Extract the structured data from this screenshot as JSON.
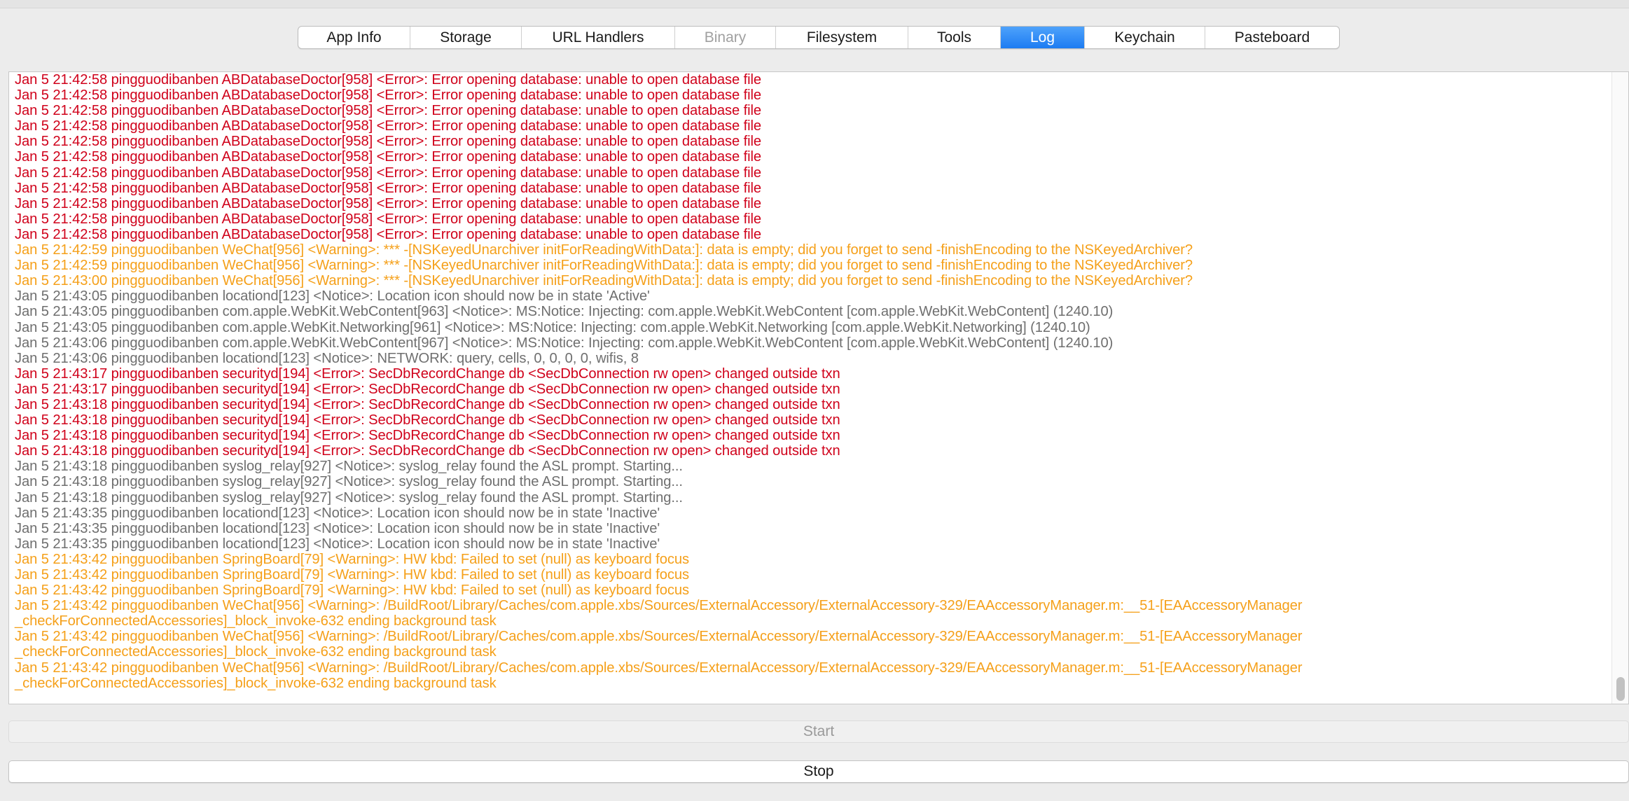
{
  "tabs": [
    {
      "label": "App Info",
      "state": "normal"
    },
    {
      "label": "Storage",
      "state": "normal"
    },
    {
      "label": "URL Handlers",
      "state": "normal"
    },
    {
      "label": "Binary",
      "state": "disabled"
    },
    {
      "label": "Filesystem",
      "state": "normal"
    },
    {
      "label": "Tools",
      "state": "normal"
    },
    {
      "label": "Log",
      "state": "active"
    },
    {
      "label": "Keychain",
      "state": "normal"
    },
    {
      "label": "Pasteboard",
      "state": "normal"
    }
  ],
  "colors": {
    "error": "#d0021b",
    "warning": "#f5a01a",
    "notice": "#6f6f6f",
    "active_tab": "#1d7cf2"
  },
  "log": [
    {
      "level": "error",
      "text": "Jan 5 21:42:58 pingguodibanben ABDatabaseDoctor[958] <Error>: Error opening database: unable to open database file"
    },
    {
      "level": "error",
      "text": "Jan 5 21:42:58 pingguodibanben ABDatabaseDoctor[958] <Error>: Error opening database: unable to open database file"
    },
    {
      "level": "error",
      "text": "Jan 5 21:42:58 pingguodibanben ABDatabaseDoctor[958] <Error>: Error opening database: unable to open database file"
    },
    {
      "level": "error",
      "text": "Jan 5 21:42:58 pingguodibanben ABDatabaseDoctor[958] <Error>: Error opening database: unable to open database file"
    },
    {
      "level": "error",
      "text": "Jan 5 21:42:58 pingguodibanben ABDatabaseDoctor[958] <Error>: Error opening database: unable to open database file"
    },
    {
      "level": "error",
      "text": "Jan 5 21:42:58 pingguodibanben ABDatabaseDoctor[958] <Error>: Error opening database: unable to open database file"
    },
    {
      "level": "error",
      "text": "Jan 5 21:42:58 pingguodibanben ABDatabaseDoctor[958] <Error>: Error opening database: unable to open database file"
    },
    {
      "level": "error",
      "text": "Jan 5 21:42:58 pingguodibanben ABDatabaseDoctor[958] <Error>: Error opening database: unable to open database file"
    },
    {
      "level": "error",
      "text": "Jan 5 21:42:58 pingguodibanben ABDatabaseDoctor[958] <Error>: Error opening database: unable to open database file"
    },
    {
      "level": "error",
      "text": "Jan 5 21:42:58 pingguodibanben ABDatabaseDoctor[958] <Error>: Error opening database: unable to open database file"
    },
    {
      "level": "error",
      "text": "Jan 5 21:42:58 pingguodibanben ABDatabaseDoctor[958] <Error>: Error opening database: unable to open database file"
    },
    {
      "level": "warning",
      "text": "Jan 5 21:42:59 pingguodibanben WeChat[956] <Warning>: *** -[NSKeyedUnarchiver initForReadingWithData:]: data is empty; did you forget to send -finishEncoding to the NSKeyedArchiver?"
    },
    {
      "level": "warning",
      "text": "Jan 5 21:42:59 pingguodibanben WeChat[956] <Warning>: *** -[NSKeyedUnarchiver initForReadingWithData:]: data is empty; did you forget to send -finishEncoding to the NSKeyedArchiver?"
    },
    {
      "level": "warning",
      "text": "Jan 5 21:43:00 pingguodibanben WeChat[956] <Warning>: *** -[NSKeyedUnarchiver initForReadingWithData:]: data is empty; did you forget to send -finishEncoding to the NSKeyedArchiver?"
    },
    {
      "level": "notice",
      "text": "Jan 5 21:43:05 pingguodibanben locationd[123] <Notice>: Location icon should now be in state 'Active'"
    },
    {
      "level": "notice",
      "text": "Jan 5 21:43:05 pingguodibanben com.apple.WebKit.WebContent[963] <Notice>: MS:Notice: Injecting: com.apple.WebKit.WebContent [com.apple.WebKit.WebContent] (1240.10)"
    },
    {
      "level": "notice",
      "text": "Jan 5 21:43:05 pingguodibanben com.apple.WebKit.Networking[961] <Notice>: MS:Notice: Injecting: com.apple.WebKit.Networking [com.apple.WebKit.Networking] (1240.10)"
    },
    {
      "level": "notice",
      "text": "Jan 5 21:43:06 pingguodibanben com.apple.WebKit.WebContent[967] <Notice>: MS:Notice: Injecting: com.apple.WebKit.WebContent [com.apple.WebKit.WebContent] (1240.10)"
    },
    {
      "level": "notice",
      "text": "Jan 5 21:43:06 pingguodibanben locationd[123] <Notice>: NETWORK: query, cells, 0, 0, 0, 0, wifis, 8"
    },
    {
      "level": "error",
      "text": "Jan 5 21:43:17 pingguodibanben securityd[194] <Error>: SecDbRecordChange db <SecDbConnection rw open> changed outside txn"
    },
    {
      "level": "error",
      "text": "Jan 5 21:43:17 pingguodibanben securityd[194] <Error>: SecDbRecordChange db <SecDbConnection rw open> changed outside txn"
    },
    {
      "level": "error",
      "text": "Jan 5 21:43:18 pingguodibanben securityd[194] <Error>: SecDbRecordChange db <SecDbConnection rw open> changed outside txn"
    },
    {
      "level": "error",
      "text": "Jan 5 21:43:18 pingguodibanben securityd[194] <Error>: SecDbRecordChange db <SecDbConnection rw open> changed outside txn"
    },
    {
      "level": "error",
      "text": "Jan 5 21:43:18 pingguodibanben securityd[194] <Error>: SecDbRecordChange db <SecDbConnection rw open> changed outside txn"
    },
    {
      "level": "error",
      "text": "Jan 5 21:43:18 pingguodibanben securityd[194] <Error>: SecDbRecordChange db <SecDbConnection rw open> changed outside txn"
    },
    {
      "level": "notice",
      "text": "Jan 5 21:43:18 pingguodibanben syslog_relay[927] <Notice>: syslog_relay found the ASL prompt. Starting..."
    },
    {
      "level": "notice",
      "text": "Jan 5 21:43:18 pingguodibanben syslog_relay[927] <Notice>: syslog_relay found the ASL prompt. Starting..."
    },
    {
      "level": "notice",
      "text": "Jan 5 21:43:18 pingguodibanben syslog_relay[927] <Notice>: syslog_relay found the ASL prompt. Starting..."
    },
    {
      "level": "notice",
      "text": "Jan 5 21:43:35 pingguodibanben locationd[123] <Notice>: Location icon should now be in state 'Inactive'"
    },
    {
      "level": "notice",
      "text": "Jan 5 21:43:35 pingguodibanben locationd[123] <Notice>: Location icon should now be in state 'Inactive'"
    },
    {
      "level": "notice",
      "text": "Jan 5 21:43:35 pingguodibanben locationd[123] <Notice>: Location icon should now be in state 'Inactive'"
    },
    {
      "level": "warning",
      "text": "Jan 5 21:43:42 pingguodibanben SpringBoard[79] <Warning>: HW kbd: Failed to set (null) as keyboard focus"
    },
    {
      "level": "warning",
      "text": "Jan 5 21:43:42 pingguodibanben SpringBoard[79] <Warning>: HW kbd: Failed to set (null) as keyboard focus"
    },
    {
      "level": "warning",
      "text": "Jan 5 21:43:42 pingguodibanben SpringBoard[79] <Warning>: HW kbd: Failed to set (null) as keyboard focus"
    },
    {
      "level": "warning",
      "text": "Jan 5 21:43:42 pingguodibanben WeChat[956] <Warning>: /BuildRoot/Library/Caches/com.apple.xbs/Sources/ExternalAccessory/ExternalAccessory-329/EAAccessoryManager.m:__51-[EAAccessoryManager"
    },
    {
      "level": "warning",
      "text": "_checkForConnectedAccessories]_block_invoke-632 ending background task"
    },
    {
      "level": "warning",
      "text": "Jan 5 21:43:42 pingguodibanben WeChat[956] <Warning>: /BuildRoot/Library/Caches/com.apple.xbs/Sources/ExternalAccessory/ExternalAccessory-329/EAAccessoryManager.m:__51-[EAAccessoryManager"
    },
    {
      "level": "warning",
      "text": "_checkForConnectedAccessories]_block_invoke-632 ending background task"
    },
    {
      "level": "warning",
      "text": "Jan 5 21:43:42 pingguodibanben WeChat[956] <Warning>: /BuildRoot/Library/Caches/com.apple.xbs/Sources/ExternalAccessory/ExternalAccessory-329/EAAccessoryManager.m:__51-[EAAccessoryManager"
    },
    {
      "level": "warning",
      "text": "_checkForConnectedAccessories]_block_invoke-632 ending background task"
    }
  ],
  "buttons": {
    "start_label": "Start",
    "stop_label": "Stop"
  }
}
